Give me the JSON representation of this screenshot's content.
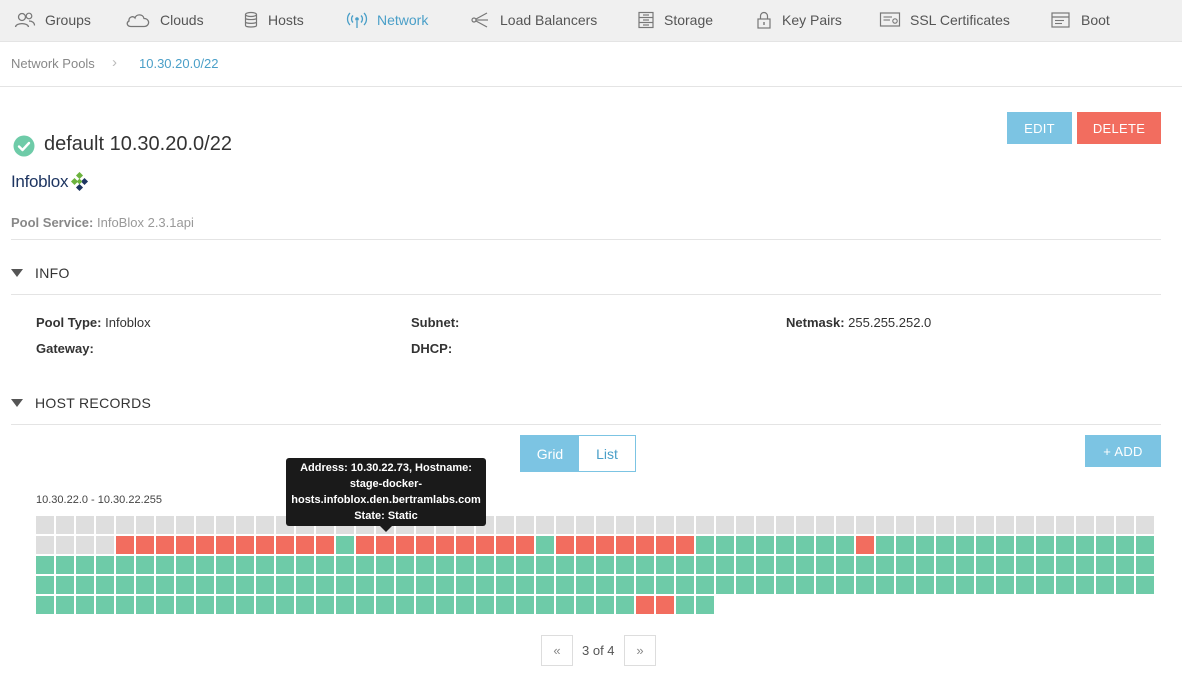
{
  "nav": {
    "items": [
      {
        "label": "Groups",
        "icon": "groups-icon"
      },
      {
        "label": "Clouds",
        "icon": "cloud-icon"
      },
      {
        "label": "Hosts",
        "icon": "server-icon"
      },
      {
        "label": "Network",
        "icon": "wifi-icon",
        "active": true
      },
      {
        "label": "Load Balancers",
        "icon": "load-balancer-icon"
      },
      {
        "label": "Storage",
        "icon": "storage-icon"
      },
      {
        "label": "Key Pairs",
        "icon": "lock-icon"
      },
      {
        "label": "SSL Certificates",
        "icon": "certificate-icon"
      },
      {
        "label": "Boot",
        "icon": "boot-icon"
      }
    ],
    "active_color": "#4a9fc8"
  },
  "breadcrumb": {
    "parent": "Network Pools",
    "current": "10.30.20.0/22"
  },
  "actions": {
    "edit_label": "EDIT",
    "delete_label": "DELETE",
    "edit_color": "#7cc4e3",
    "delete_color": "#f26d5f"
  },
  "pool": {
    "title": "default 10.30.20.0/22",
    "status_icon": "check-circle-icon",
    "status_color": "#6ecba8",
    "logo_text": "Infoblox",
    "service_label": "Pool Service:",
    "service_value": "InfoBlox 2.3.1api"
  },
  "info": {
    "heading": "INFO",
    "fields": [
      {
        "label": "Pool Type:",
        "value": "Infoblox"
      },
      {
        "label": "Subnet:",
        "value": ""
      },
      {
        "label": "Netmask:",
        "value": "255.255.252.0"
      },
      {
        "label": "Gateway:",
        "value": ""
      },
      {
        "label": "DHCP:",
        "value": ""
      }
    ]
  },
  "host_records": {
    "heading": "HOST RECORDS",
    "view_grid_label": "Grid",
    "view_list_label": "List",
    "add_label": "+ ADD",
    "range_label": "10.30.22.0 - 10.30.22.255",
    "tooltip": {
      "line1": "Address: 10.30.22.73, Hostname:",
      "line2": "stage-docker-",
      "line3": "hosts.infoblox.den.bertramlabs.com",
      "line4": "State: Static"
    },
    "grid": {
      "columns": 56,
      "total_cells": 256,
      "colors": {
        "free": "#dedede",
        "static": "#f26d5f",
        "used": "#6ecba8"
      },
      "rows": [
        "ffffffffffffffffffffffffffffffffffffffffffffffffffffffff",
        "ffffsssssssssssusssssssssusssssssuuuuuuuuuuuuuuuuuuuuuuu",
        "uuuuuuuuuuuuuuuuuuuuuuuuuuuuuuuuuuuuuuuuuuuuuuuuuuuuuuuu",
        "uuuuuuuuuuuuuuuuuuuuuuuuuuuuuuuuuuuuuuuuuuuuuuuuuuuuuuuu",
        "uuuuuuuuuuuuuuuuuuuuuuuuuuuuuussuu"
      ],
      "overrides": [
        {
          "row": 1,
          "col": 41,
          "state": "s"
        }
      ]
    },
    "pager": {
      "prev": "«",
      "next": "»",
      "text": "3 of 4"
    }
  }
}
